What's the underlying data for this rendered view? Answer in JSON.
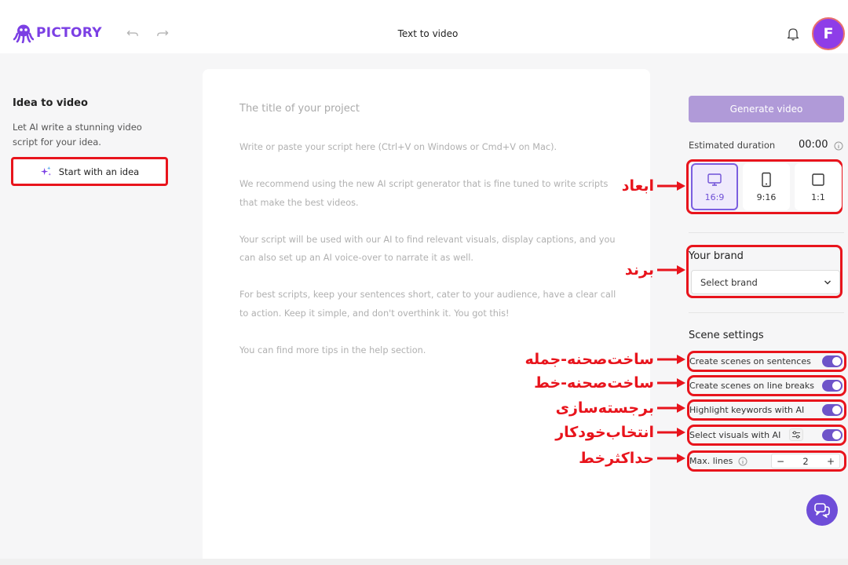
{
  "header": {
    "brand": "PICTORY",
    "title": "Text to video",
    "avatar_initial": "F"
  },
  "sidebar": {
    "title": "Idea to video",
    "description": "Let AI write a stunning video script for your idea.",
    "idea_button": "Start with an idea"
  },
  "editor": {
    "title_placeholder": "The title of your project",
    "paragraphs": [
      "Write or paste your script here (Ctrl+V on Windows or Cmd+V on Mac).",
      "We recommend using the new AI script generator that is fine tuned to write scripts that make the best videos.",
      "Your script will be used with our AI to find relevant visuals, display captions, and you can also set up an AI voice-over to narrate it as well.",
      "For best scripts, keep your sentences short, cater to your audience, have a clear call to action. Keep it simple, and don't overthink it. You got this!",
      "You can find more tips in the help section."
    ]
  },
  "panel": {
    "generate_button": "Generate video",
    "estimated_label": "Estimated duration",
    "estimated_value": "00:00",
    "aspect_ratios": [
      {
        "label": "16:9",
        "icon": "monitor-icon",
        "active": true
      },
      {
        "label": "9:16",
        "icon": "phone-icon",
        "active": false
      },
      {
        "label": "1:1",
        "icon": "square-icon",
        "active": false
      }
    ],
    "brand_title": "Your brand",
    "brand_select": "Select brand",
    "scene_title": "Scene settings",
    "scene_options": [
      {
        "label": "Create scenes on sentences",
        "enabled": true
      },
      {
        "label": "Create scenes on line breaks",
        "enabled": true
      },
      {
        "label": "Highlight keywords with AI",
        "enabled": true
      },
      {
        "label": "Select visuals with AI",
        "enabled": true
      }
    ],
    "max_lines_label": "Max. lines",
    "max_lines_value": "2",
    "stepper_minus": "−",
    "stepper_plus": "+"
  },
  "annotations": {
    "aspect": "ابعاد",
    "brand": "برند",
    "sentences": "ساخت‌صحنه-جمله",
    "line_breaks": "ساخت‌صحنه-خط",
    "highlight": "برجسته‌سازی",
    "auto_select": "انتخاب‌خودکار",
    "max_lines": "حداکثرخط"
  },
  "colors": {
    "brand_purple": "#7b3fe4",
    "annotation_red": "#e8141c",
    "toggle_on": "#6e54c9"
  }
}
